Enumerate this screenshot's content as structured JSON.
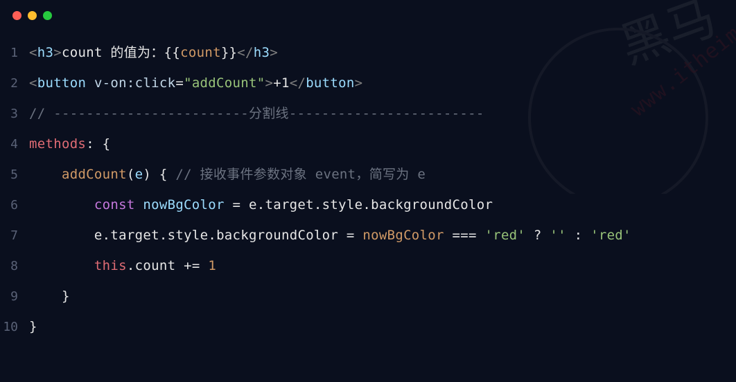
{
  "titlebar": {
    "dots": [
      "red",
      "yellow",
      "green"
    ]
  },
  "watermark": {
    "url": "www.itheima",
    "text": "黑马"
  },
  "code": {
    "lines": [
      {
        "n": "1",
        "tokens": [
          {
            "t": "<",
            "c": "c-punc"
          },
          {
            "t": "h3",
            "c": "c-tag"
          },
          {
            "t": ">",
            "c": "c-punc"
          },
          {
            "t": "count 的值为：",
            "c": "c-text"
          },
          {
            "t": "{{",
            "c": "c-brace"
          },
          {
            "t": "count",
            "c": "c-orange"
          },
          {
            "t": "}}",
            "c": "c-brace"
          },
          {
            "t": "</",
            "c": "c-punc"
          },
          {
            "t": "h3",
            "c": "c-tag"
          },
          {
            "t": ">",
            "c": "c-punc"
          }
        ]
      },
      {
        "n": "2",
        "tokens": [
          {
            "t": "<",
            "c": "c-punc"
          },
          {
            "t": "button ",
            "c": "c-tag"
          },
          {
            "t": "v-on:click",
            "c": "c-attr"
          },
          {
            "t": "=",
            "c": "c-text"
          },
          {
            "t": "\"addCount\"",
            "c": "c-str"
          },
          {
            "t": ">",
            "c": "c-punc"
          },
          {
            "t": "+1",
            "c": "c-text"
          },
          {
            "t": "</",
            "c": "c-punc"
          },
          {
            "t": "button",
            "c": "c-tag"
          },
          {
            "t": ">",
            "c": "c-punc"
          }
        ]
      },
      {
        "n": "3",
        "tokens": [
          {
            "t": "// ------------------------分割线------------------------",
            "c": "c-comment"
          }
        ]
      },
      {
        "n": "4",
        "tokens": [
          {
            "t": "methods",
            "c": "c-red"
          },
          {
            "t": ": {",
            "c": "c-text"
          }
        ]
      },
      {
        "n": "5",
        "tokens": [
          {
            "t": "    ",
            "c": "c-text"
          },
          {
            "t": "addCount",
            "c": "c-orange"
          },
          {
            "t": "(",
            "c": "c-text"
          },
          {
            "t": "e",
            "c": "c-var"
          },
          {
            "t": ") { ",
            "c": "c-text"
          },
          {
            "t": "// 接收事件参数对象 event，简写为 e",
            "c": "c-comment"
          }
        ]
      },
      {
        "n": "6",
        "tokens": [
          {
            "t": "        ",
            "c": "c-text"
          },
          {
            "t": "const ",
            "c": "c-kw"
          },
          {
            "t": "nowBgColor",
            "c": "c-var"
          },
          {
            "t": " = ",
            "c": "c-op"
          },
          {
            "t": "e",
            "c": "c-text"
          },
          {
            "t": ".",
            "c": "c-text"
          },
          {
            "t": "target",
            "c": "c-prop"
          },
          {
            "t": ".",
            "c": "c-text"
          },
          {
            "t": "style",
            "c": "c-prop"
          },
          {
            "t": ".",
            "c": "c-text"
          },
          {
            "t": "backgroundColor",
            "c": "c-prop"
          }
        ]
      },
      {
        "n": "7",
        "tokens": [
          {
            "t": "        ",
            "c": "c-text"
          },
          {
            "t": "e",
            "c": "c-text"
          },
          {
            "t": ".",
            "c": "c-text"
          },
          {
            "t": "target",
            "c": "c-prop"
          },
          {
            "t": ".",
            "c": "c-text"
          },
          {
            "t": "style",
            "c": "c-prop"
          },
          {
            "t": ".",
            "c": "c-text"
          },
          {
            "t": "backgroundColor",
            "c": "c-prop"
          },
          {
            "t": " = ",
            "c": "c-op"
          },
          {
            "t": "nowBgColor",
            "c": "c-orange"
          },
          {
            "t": " === ",
            "c": "c-op"
          },
          {
            "t": "'red'",
            "c": "c-str"
          },
          {
            "t": " ? ",
            "c": "c-op"
          },
          {
            "t": "''",
            "c": "c-str"
          },
          {
            "t": " : ",
            "c": "c-op"
          },
          {
            "t": "'red'",
            "c": "c-str"
          }
        ]
      },
      {
        "n": "8",
        "tokens": [
          {
            "t": "        ",
            "c": "c-text"
          },
          {
            "t": "this",
            "c": "c-this"
          },
          {
            "t": ".",
            "c": "c-text"
          },
          {
            "t": "count",
            "c": "c-prop"
          },
          {
            "t": " += ",
            "c": "c-op"
          },
          {
            "t": "1",
            "c": "c-num"
          }
        ]
      },
      {
        "n": "9",
        "tokens": [
          {
            "t": "    }",
            "c": "c-text"
          }
        ]
      },
      {
        "n": "10",
        "tokens": [
          {
            "t": "}",
            "c": "c-text"
          }
        ]
      }
    ]
  }
}
